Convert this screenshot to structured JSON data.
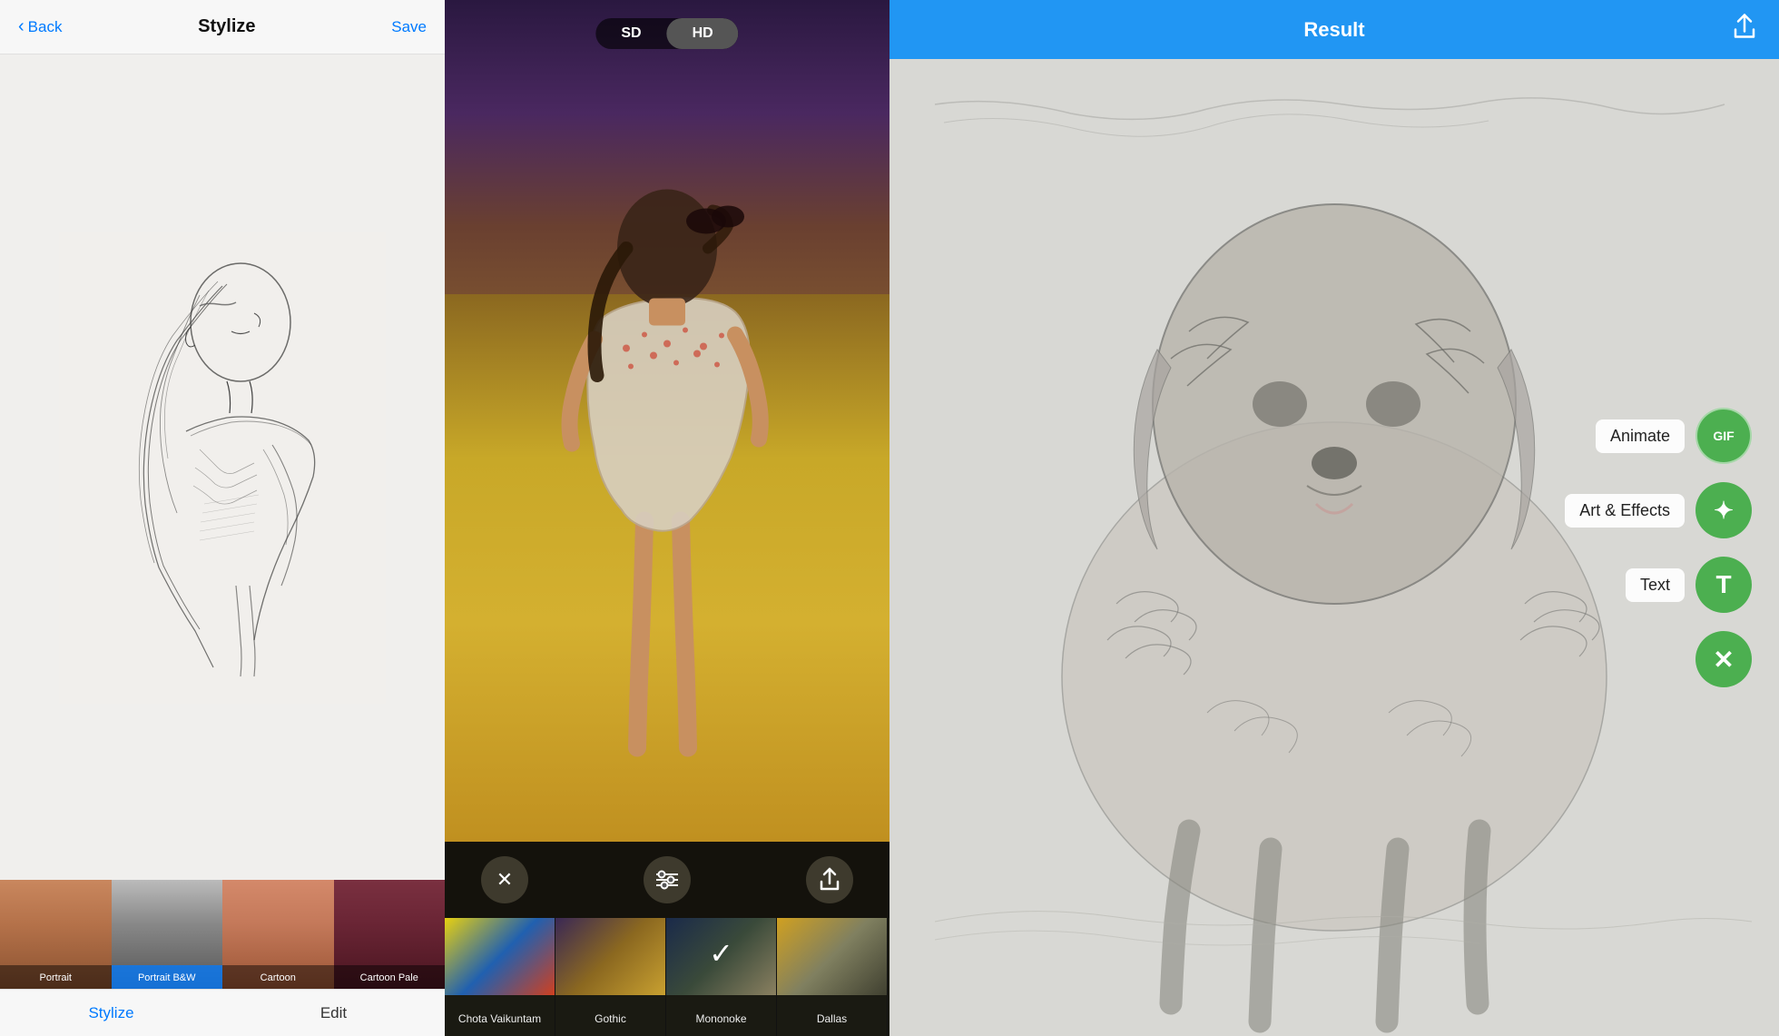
{
  "panel1": {
    "header": {
      "back_label": "Back",
      "title": "Stylize",
      "save_label": "Save"
    },
    "thumbnails": [
      {
        "label": "Portrait",
        "style": "portrait",
        "active": false
      },
      {
        "label": "Portrait B&W",
        "style": "bw",
        "active": true
      },
      {
        "label": "Cartoon",
        "style": "cartoon",
        "active": false
      },
      {
        "label": "Cartoon Pale",
        "style": "cartoon-pale",
        "active": false
      }
    ],
    "tabs": [
      {
        "label": "Stylize",
        "active": true
      },
      {
        "label": "Edit",
        "active": false
      }
    ]
  },
  "panel2": {
    "quality": {
      "sd_label": "SD",
      "hd_label": "HD"
    },
    "controls": {
      "close_icon": "✕",
      "sliders_icon": "⊟",
      "share_icon": "⬆"
    },
    "filters": [
      {
        "label": "Chota Vaikuntam",
        "style": "ft1"
      },
      {
        "label": "Gothic",
        "style": "ft2",
        "checkmark": true
      },
      {
        "label": "Mononoke",
        "style": "ft3",
        "selected": true
      },
      {
        "label": "Dallas",
        "style": "ft4"
      }
    ]
  },
  "panel3": {
    "header": {
      "title": "Result",
      "share_icon": "⬆"
    },
    "actions": [
      {
        "label": "Animate",
        "icon": "GIF",
        "icon_type": "gif"
      },
      {
        "label": "Art & Effects",
        "icon": "✦",
        "icon_type": "effects"
      },
      {
        "label": "Text",
        "icon": "T",
        "icon_type": "text"
      },
      {
        "label": "",
        "icon": "✕",
        "icon_type": "close"
      }
    ]
  }
}
